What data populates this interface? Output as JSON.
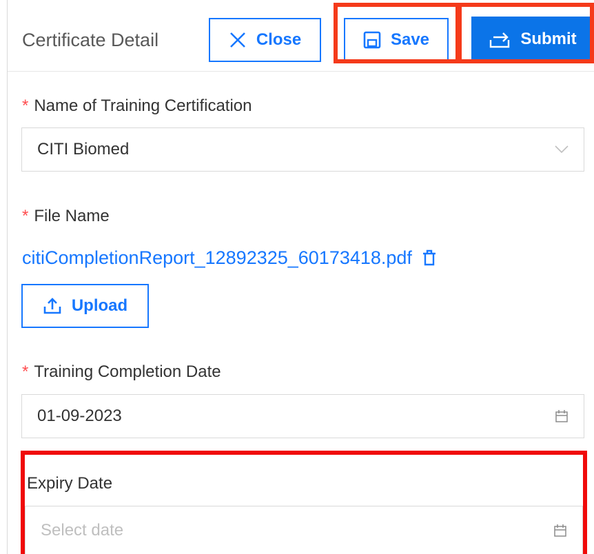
{
  "header": {
    "title": "Certificate Detail",
    "close_label": "Close",
    "save_label": "Save",
    "submit_label": "Submit"
  },
  "form": {
    "certification": {
      "label": "Name of Training Certification",
      "required": true,
      "value": "CITI Biomed"
    },
    "file": {
      "label": "File Name",
      "required": true,
      "file_name": "citiCompletionReport_12892325_60173418.pdf",
      "upload_label": "Upload"
    },
    "completion_date": {
      "label": "Training Completion Date",
      "required": true,
      "value": "01-09-2023"
    },
    "expiry_date": {
      "label": "Expiry Date",
      "placeholder": "Select date"
    }
  },
  "colors": {
    "primary": "#1677ff",
    "required": "#ff4d4f",
    "highlight": "#f53a1a"
  },
  "icons": {
    "close": "close-icon",
    "save": "save-icon",
    "submit": "submit-icon",
    "dropdown": "chevron-down-icon",
    "delete": "trash-icon",
    "upload": "upload-icon",
    "calendar": "calendar-icon"
  }
}
